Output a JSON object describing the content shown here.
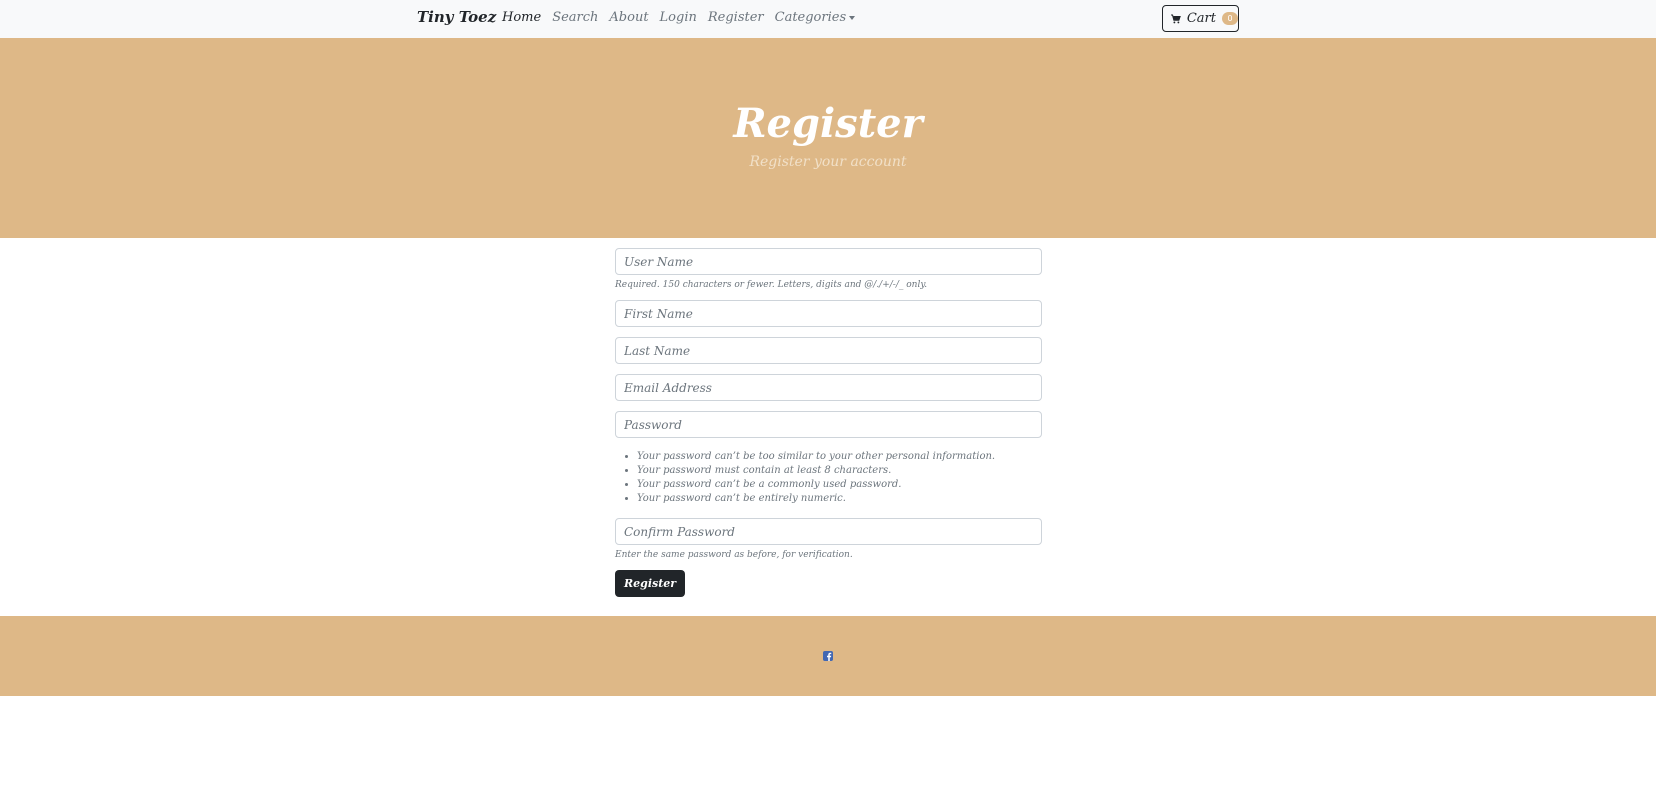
{
  "navbar": {
    "brand": "Tiny Toez",
    "links": [
      "Home",
      "Search",
      "About",
      "Login",
      "Register",
      "Categories"
    ],
    "cart_label": "Cart",
    "cart_count": "0"
  },
  "hero": {
    "title": "Register",
    "subtitle": "Register your account"
  },
  "form": {
    "username_placeholder": "User Name",
    "username_help": "Required. 150 characters or fewer. Letters, digits and @/./+/-/_ only.",
    "first_name_placeholder": "First Name",
    "last_name_placeholder": "Last Name",
    "email_placeholder": "Email Address",
    "password_placeholder": "Password",
    "password_rules": [
      "Your password can’t be too similar to your other personal information.",
      "Your password must contain at least 8 characters.",
      "Your password can’t be a commonly used password.",
      "Your password can’t be entirely numeric."
    ],
    "confirm_placeholder": "Confirm Password",
    "confirm_help": "Enter the same password as before, for verification.",
    "submit_label": "Register"
  },
  "icons": {
    "cart": "cart-icon",
    "footer": "facebook-icon"
  },
  "colors": {
    "accent": "#deb887",
    "navbar_bg": "#f8f9fa",
    "button_dark": "#212529"
  }
}
